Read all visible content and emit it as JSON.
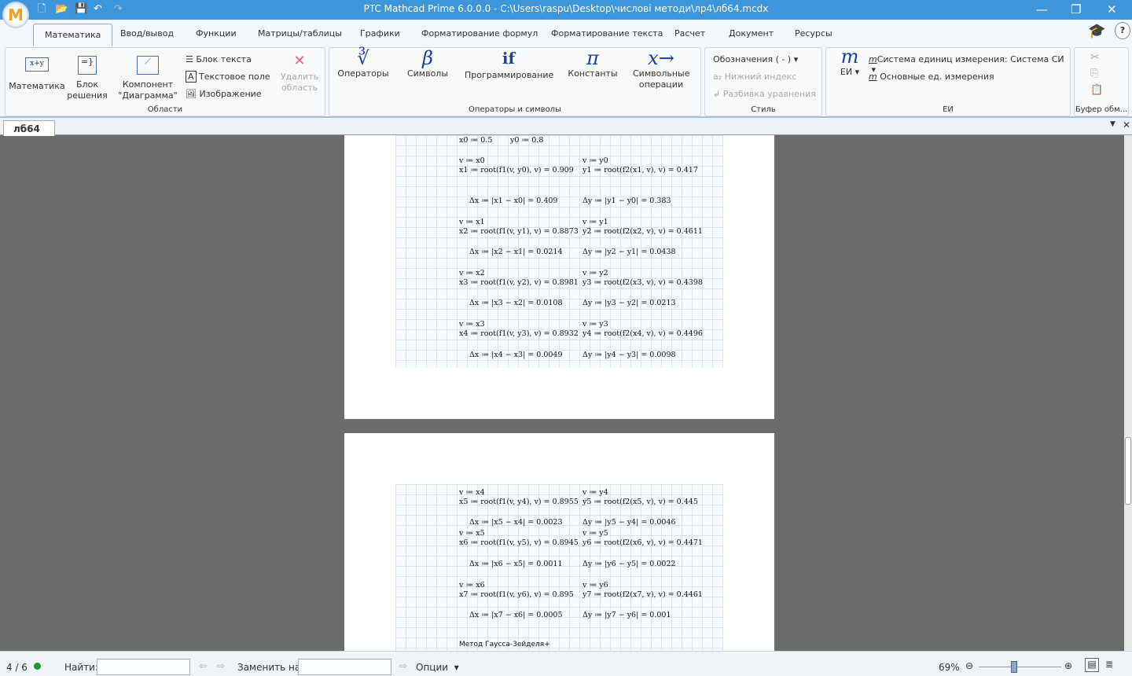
{
  "window": {
    "title": "PTC Mathcad Prime 6.0.0.0 - C:\\Users\\raspu\\Desktop\\числові методи\\лр4\\лб64.mcdx",
    "logo": "M"
  },
  "tabs": [
    "Математика",
    "Ввод/вывод",
    "Функции",
    "Матрицы/таблицы",
    "Графики",
    "Форматирование формул",
    "Форматирование текста",
    "Расчет",
    "Документ",
    "Ресурсы"
  ],
  "ribbon": {
    "regions": {
      "label": "Области",
      "math": "Математика",
      "solve1": "Блок",
      "solve2": "решения",
      "chart1": "Компонент",
      "chart2": "\"Диаграмма\"",
      "textblock": "Блок текста",
      "textbox": "Текстовое поле",
      "image": "Изображение",
      "del1": "Удалить",
      "del2": "область"
    },
    "ops": {
      "label": "Операторы и символы",
      "operators": "Операторы",
      "symbols": "Символы",
      "programming": "Программирование",
      "constants": "Константы",
      "sym1": "Символьные",
      "sym2": "операции",
      "if": "if",
      "pi": "π",
      "beta": "β",
      "xarrow": "x→",
      "root": "∛"
    },
    "style": {
      "label": "Стиль",
      "labels": "Обозначения  ( - )",
      "subscript": "Нижний индекс",
      "break": "Разбивка уравнения"
    },
    "units": {
      "label": "ЕИ",
      "ei": "ЕИ",
      "m": "m",
      "system_label": "Система единиц измерения:",
      "system_value": "Система СИ",
      "base": "Основные ед. измерения"
    },
    "clipboard": {
      "label": "Буфер обм..."
    }
  },
  "doc_tab": "лб64",
  "math": {
    "page1": [
      {
        "l": "x0 ≔ 0.5",
        "r": "y0 ≔ 0.8",
        "rx": "sm"
      },
      {
        "l": "v ≔ x0",
        "r": "v ≔ y0"
      },
      {
        "l": "x1 ≔ root(f1(v, y0), v) = 0.909",
        "r": "y1 ≔ root(f2(x1, v), v) = 0.417"
      },
      {
        "l": "Δx ≔ |x1 − x0| = 0.409",
        "r": "Δy ≔ |y1 − y0| = 0.383",
        "d": 1
      },
      {
        "l": "v ≔ x1",
        "r": "v ≔ y1"
      },
      {
        "l": "x2 ≔ root(f1(v, y1), v) = 0.8873",
        "r": "y2 ≔ root(f2(x2, v), v) = 0.4611"
      },
      {
        "l": "Δx ≔ |x2 − x1| = 0.0214",
        "r": "Δy ≔ |y2 − y1| = 0.0438",
        "d": 1
      },
      {
        "l": "v ≔ x2",
        "r": "v ≔ y2"
      },
      {
        "l": "x3 ≔ root(f1(v, y2), v) = 0.8981",
        "r": "y3 ≔ root(f2(x3, v), v) = 0.4398"
      },
      {
        "l": "Δx ≔ |x3 − x2| = 0.0108",
        "r": "Δy ≔ |y3 − y2| = 0.0213",
        "d": 1
      },
      {
        "l": "v ≔ x3",
        "r": "v ≔ y3"
      },
      {
        "l": "x4 ≔ root(f1(v, y3), v) = 0.8932",
        "r": "y4 ≔ root(f2(x4, v), v) = 0.4496"
      },
      {
        "l": "Δx ≔ |x4 − x3| = 0.0049",
        "r": "Δy ≔ |y4 − y3| = 0.0098",
        "d": 1
      }
    ],
    "page2": [
      {
        "l": "v ≔ x4",
        "r": "v ≔ y4"
      },
      {
        "l": "x5 ≔ root(f1(v, y4), v) = 0.8955",
        "r": "y5 ≔ root(f2(x5, v), v) = 0.445"
      },
      {
        "l": "Δx ≔ |x5 − x4| = 0.0023",
        "r": "Δy ≔ |y5 − y4| = 0.0046",
        "d": 1
      },
      {
        "l": "v ≔ x5",
        "r": "v ≔ y5"
      },
      {
        "l": "x6 ≔ root(f1(v, y5), v) = 0.8945",
        "r": "y6 ≔ root(f2(x6, v), v) = 0.4471"
      },
      {
        "l": "Δx ≔ |x6 − x5| = 0.0011",
        "r": "Δy ≔ |y6 − y5| = 0.0022",
        "d": 1
      },
      {
        "l": "v ≔ x6",
        "r": "v ≔ y6"
      },
      {
        "l": "x7 ≔ root(f1(v, y6), v) = 0.895",
        "r": "y7 ≔ root(f2(x7, v), v) = 0.4461"
      },
      {
        "l": "Δx ≔ |x7 − x6| = 0.0005",
        "r": "Δy ≔ |y7 − y6| = 0.001",
        "d": 1
      }
    ],
    "heading": "Метод Гаусса-Зейделя+"
  },
  "status": {
    "page": "4 / 6",
    "find_label": "Найти:",
    "find_value": "",
    "replace_label": "Заменить на:",
    "replace_value": "",
    "options": "Опции",
    "zoom": "69%",
    "zoom_fraction": 0.69
  }
}
